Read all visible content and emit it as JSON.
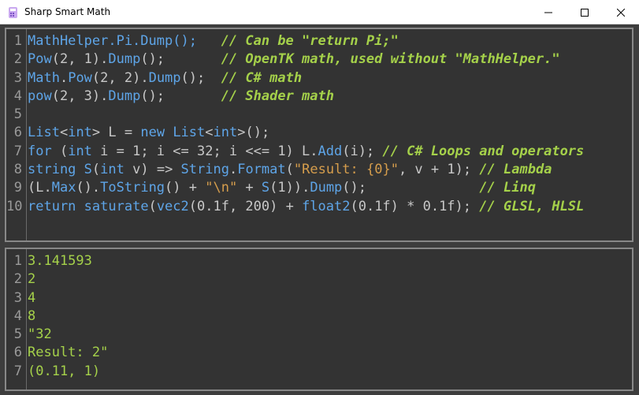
{
  "window": {
    "title": "Sharp Smart Math",
    "app_icon": "math-app-icon"
  },
  "window_controls": [
    "minimize-icon",
    "maximize-icon",
    "close-icon"
  ],
  "colors": {
    "editor_bg": "#333333",
    "identifier": "#5ea5e8",
    "plain": "#c8c8c8",
    "string": "#d59d4c",
    "comment": "#a5d14a",
    "line_number": "#9a9a9a"
  },
  "editor": {
    "lines": [
      {
        "n": "1",
        "parts": [
          {
            "t": "MathHelper.Pi.Dump();",
            "c": "c-id"
          },
          {
            "t": "   ",
            "c": "c-pl"
          },
          {
            "t": "// Can be \"return Pi;\"",
            "c": "c-com"
          }
        ]
      },
      {
        "n": "2",
        "parts": [
          {
            "t": "Pow",
            "c": "c-id"
          },
          {
            "t": "(2, 1).",
            "c": "c-pl"
          },
          {
            "t": "Dump",
            "c": "c-id"
          },
          {
            "t": "();",
            "c": "c-pl"
          },
          {
            "t": "       ",
            "c": "c-pl"
          },
          {
            "t": "// OpenTK math, used without \"MathHelper.\"",
            "c": "c-com"
          }
        ]
      },
      {
        "n": "3",
        "parts": [
          {
            "t": "Math",
            "c": "c-id"
          },
          {
            "t": ".",
            "c": "c-pl"
          },
          {
            "t": "Pow",
            "c": "c-id"
          },
          {
            "t": "(2, 2).",
            "c": "c-pl"
          },
          {
            "t": "Dump",
            "c": "c-id"
          },
          {
            "t": "();",
            "c": "c-pl"
          },
          {
            "t": "  ",
            "c": "c-pl"
          },
          {
            "t": "// C# math",
            "c": "c-com"
          }
        ]
      },
      {
        "n": "4",
        "parts": [
          {
            "t": "pow",
            "c": "c-id"
          },
          {
            "t": "(2, 3).",
            "c": "c-pl"
          },
          {
            "t": "Dump",
            "c": "c-id"
          },
          {
            "t": "();",
            "c": "c-pl"
          },
          {
            "t": "       ",
            "c": "c-pl"
          },
          {
            "t": "// Shader math",
            "c": "c-com"
          }
        ]
      },
      {
        "n": "5",
        "parts": []
      },
      {
        "n": "6",
        "parts": [
          {
            "t": "List",
            "c": "c-id"
          },
          {
            "t": "<",
            "c": "c-pl"
          },
          {
            "t": "int",
            "c": "c-kw"
          },
          {
            "t": "> L = ",
            "c": "c-pl"
          },
          {
            "t": "new",
            "c": "c-kw"
          },
          {
            "t": " ",
            "c": "c-pl"
          },
          {
            "t": "List",
            "c": "c-id"
          },
          {
            "t": "<",
            "c": "c-pl"
          },
          {
            "t": "int",
            "c": "c-kw"
          },
          {
            "t": ">();",
            "c": "c-pl"
          }
        ]
      },
      {
        "n": "7",
        "parts": [
          {
            "t": "for",
            "c": "c-kw"
          },
          {
            "t": " (",
            "c": "c-pl"
          },
          {
            "t": "int",
            "c": "c-kw"
          },
          {
            "t": " i = 1; i <= 32; i <<= 1) L.",
            "c": "c-pl"
          },
          {
            "t": "Add",
            "c": "c-id"
          },
          {
            "t": "(i); ",
            "c": "c-pl"
          },
          {
            "t": "// C# Loops and operators",
            "c": "c-com"
          }
        ]
      },
      {
        "n": "8",
        "parts": [
          {
            "t": "string",
            "c": "c-kw"
          },
          {
            "t": " ",
            "c": "c-pl"
          },
          {
            "t": "S",
            "c": "c-id"
          },
          {
            "t": "(",
            "c": "c-pl"
          },
          {
            "t": "int",
            "c": "c-kw"
          },
          {
            "t": " v) => ",
            "c": "c-pl"
          },
          {
            "t": "String",
            "c": "c-id"
          },
          {
            "t": ".",
            "c": "c-pl"
          },
          {
            "t": "Format",
            "c": "c-id"
          },
          {
            "t": "(",
            "c": "c-pl"
          },
          {
            "t": "\"Result: {0}\"",
            "c": "c-str"
          },
          {
            "t": ", v + 1); ",
            "c": "c-pl"
          },
          {
            "t": "// Lambda",
            "c": "c-com"
          }
        ]
      },
      {
        "n": "9",
        "parts": [
          {
            "t": "(L.",
            "c": "c-pl"
          },
          {
            "t": "Max",
            "c": "c-id"
          },
          {
            "t": "().",
            "c": "c-pl"
          },
          {
            "t": "ToString",
            "c": "c-id"
          },
          {
            "t": "() + ",
            "c": "c-pl"
          },
          {
            "t": "\"\\n\"",
            "c": "c-str"
          },
          {
            "t": " + ",
            "c": "c-pl"
          },
          {
            "t": "S",
            "c": "c-id"
          },
          {
            "t": "(1)).",
            "c": "c-pl"
          },
          {
            "t": "Dump",
            "c": "c-id"
          },
          {
            "t": "();",
            "c": "c-pl"
          },
          {
            "t": "              ",
            "c": "c-pl"
          },
          {
            "t": "// Linq",
            "c": "c-com"
          }
        ]
      },
      {
        "n": "10",
        "parts": [
          {
            "t": "return",
            "c": "c-kw"
          },
          {
            "t": " ",
            "c": "c-pl"
          },
          {
            "t": "saturate",
            "c": "c-id"
          },
          {
            "t": "(",
            "c": "c-pl"
          },
          {
            "t": "vec2",
            "c": "c-id"
          },
          {
            "t": "(0.1f, 200) + ",
            "c": "c-pl"
          },
          {
            "t": "float2",
            "c": "c-id"
          },
          {
            "t": "(0.1f) * 0.1f); ",
            "c": "c-pl"
          },
          {
            "t": "// GLSL, HLSL",
            "c": "c-com"
          }
        ]
      }
    ]
  },
  "output": {
    "lines": [
      {
        "n": "1",
        "text": "3.141593"
      },
      {
        "n": "2",
        "text": "2"
      },
      {
        "n": "3",
        "text": "4"
      },
      {
        "n": "4",
        "text": "8"
      },
      {
        "n": "5",
        "text": "\"32"
      },
      {
        "n": "6",
        "text": "Result: 2\""
      },
      {
        "n": "7",
        "text": "(0.11, 1)"
      }
    ]
  }
}
